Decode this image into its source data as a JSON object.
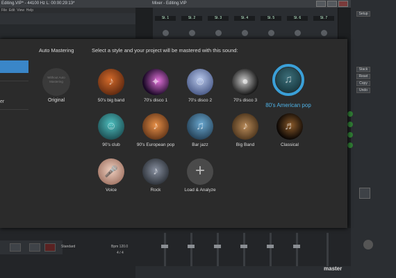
{
  "background": {
    "left_window_title": "Editing.VIP* - 44100 Hz L: 00:00:29:13*",
    "left_menu": [
      "File",
      "Edit",
      "View",
      "Help"
    ],
    "mixer_title": "Mixer - Editing.VIP",
    "channel_labels": [
      "St. 1",
      "St. 2",
      "St. 3",
      "St. 4",
      "St. 5",
      "St. 6",
      "St. 7"
    ],
    "right_panel_buttons": [
      "Setup",
      "Stack",
      "Reset",
      "Copy",
      "Undo"
    ],
    "master_label": "master",
    "transport": {
      "mode": "Standard",
      "tempo": "Bpm 120.0",
      "signature": "4 / 4"
    },
    "colors": {
      "accent": "#3a86c8",
      "mixer_bg": "#1d1f21",
      "dialog_bg": "#2b2b2b"
    }
  },
  "dialog": {
    "title": "Auto Mastering",
    "instruction": "Select a style and your project will be mastered with this sound:",
    "original": {
      "inner_text": "Without Auto Mastering",
      "label": "Original"
    },
    "selected_style": "80's American pop",
    "styles": [
      {
        "label": "50's big band",
        "color": "#8a3a1c",
        "icon": "trumpet-icon"
      },
      {
        "label": "70's disco 1",
        "color": "#6b2a8c",
        "icon": "disco-light-icon"
      },
      {
        "label": "70's disco 2",
        "color": "#4a5f9a",
        "icon": "dancer-icon"
      },
      {
        "label": "70's disco 3",
        "color": "#5a5a5a",
        "icon": "disco-ball-icon"
      },
      {
        "label": "90's club",
        "color": "#2a8c8c",
        "icon": "club-dancer-icon"
      },
      {
        "label": "90's European pop",
        "color": "#b05a1e",
        "icon": "singer-icon"
      },
      {
        "label": "Bar jazz",
        "color": "#2e5a7a",
        "icon": "saxophone-icon"
      },
      {
        "label": "Big Band",
        "color": "#6a4a2a",
        "icon": "brass-icon"
      },
      {
        "label": "Classical",
        "color": "#2a1a0e",
        "icon": "violin-icon"
      },
      {
        "label": "Voice",
        "color": "#c8a088",
        "icon": "microphone-icon"
      },
      {
        "label": "Rock",
        "color": "#3a4048",
        "icon": "guitar-icon"
      }
    ],
    "load_analyze": {
      "label": "Load & Analyze",
      "icon": "plus-icon"
    }
  }
}
